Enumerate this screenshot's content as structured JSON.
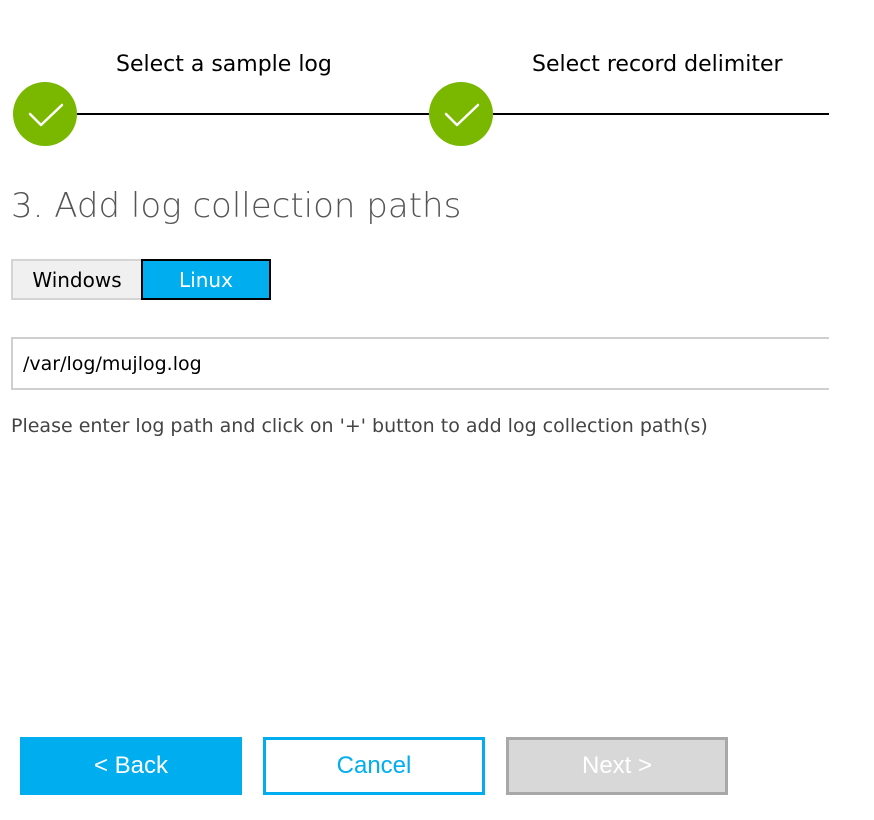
{
  "wizard": {
    "steps": [
      {
        "label": "Select a sample log",
        "status": "completed"
      },
      {
        "label": "Select record delimiter",
        "status": "completed"
      }
    ],
    "completed_color": "#7ab800"
  },
  "page": {
    "title": "3. Add log collection paths"
  },
  "os_toggle": {
    "options": [
      "Windows",
      "Linux"
    ],
    "selected": "Linux",
    "accent": "#00aeef"
  },
  "path_input": {
    "value": "/var/log/mujlog.log"
  },
  "helper_text": "Please enter log path and click on '+' button to add log collection path(s)",
  "footer": {
    "back_label": "< Back",
    "cancel_label": "Cancel",
    "next_label": "Next >",
    "next_disabled": true
  },
  "icons": {
    "completed": "checkmark-icon"
  }
}
